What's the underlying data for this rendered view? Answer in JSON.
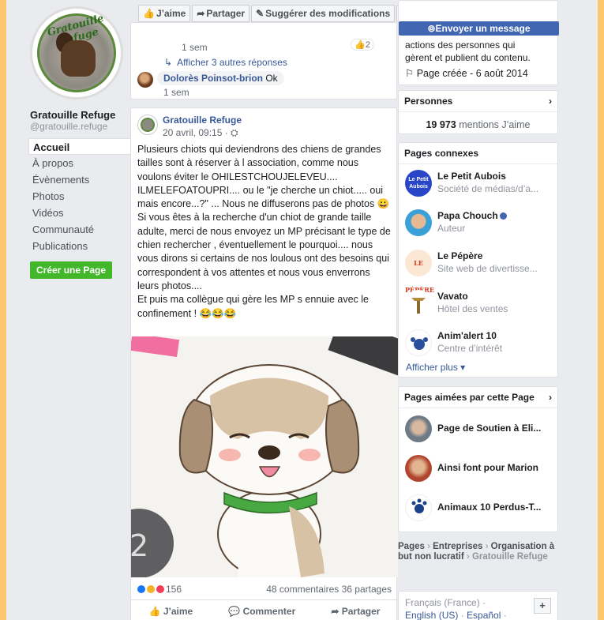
{
  "left": {
    "page_name": "Gratouille Refuge",
    "page_handle": "@gratouille.refuge",
    "nav": [
      "Accueil",
      "À propos",
      "Évènements",
      "Photos",
      "Vidéos",
      "Communauté",
      "Publications"
    ],
    "create_page": "Créer une Page",
    "logo_text": "Gratouille Refuge"
  },
  "actionbar": {
    "like": " J’aime",
    "share": " Partager",
    "suggest": " Suggérer des modifications",
    "more": "···"
  },
  "comments": {
    "time1": "1 sem",
    "badge": "2",
    "more_replies": "Afficher 3 autres réponses",
    "commenter": "Dolorès Poinsot-brion",
    "comment_text": "Ok",
    "time2": "1 sem"
  },
  "post": {
    "author": "Gratouille Refuge",
    "date": "20 avril, 09:15 · ⛭",
    "paragraphs": [
      "Plusieurs chiots qui deviendrons des chiens de grandes tailles sont à réserver à l association, comme nous voulons éviter le OHILESTCHOUJELEVEU.... ILMELEFOATOUPRI.... ou le \"je cherche un chiot..... oui mais encore...?\" ... Nous ne diffuserons pas de photos 😀",
      "Si vous êtes à la recherche d'un chiot de grande taille adulte, merci de nous envoyez un MP précisant le type de chien rechercher , éventuellement le pourquoi.... nous vous dirons si certains de nos loulous ont des besoins qui correspondent à vos attentes et nous vous enverrons leurs photos....",
      "Et puis ma collègue qui gère les MP s ennuie avec le confinement ! 😂😂😂"
    ],
    "image_digit": "2",
    "reactions_count": "156",
    "comments_count": "48 commentaires",
    "shares_count": "36 partages",
    "like": "J’aime",
    "comment": "Commenter",
    "share": "Partager"
  },
  "right": {
    "message_button": "Envoyer un message",
    "about_line1": "actions des personnes qui",
    "about_line2": "gèrent et publient du contenu.",
    "created": "Page créée - 6 août 2014",
    "persons_title": "Personnes",
    "persons_number": "19 973",
    "persons_suffix": " mentions J’aime",
    "related_title": "Pages connexes",
    "related": [
      {
        "name": "Le Petit Aubois",
        "sub": "Société de médias/d’a...",
        "avatar_text": "Le Petit Aubois"
      },
      {
        "name": "Papa Chouch",
        "sub": "Auteur"
      },
      {
        "name": "Le Pépère",
        "sub": "Site web de divertisse...",
        "avatar_text": "LE PÉPÈRE"
      },
      {
        "name": "Vavato",
        "sub": "Hôtel des ventes"
      },
      {
        "name": "Anim'alert 10",
        "sub": "Centre d’intérêt"
      }
    ],
    "show_more": "Afficher plus",
    "liked_title": "Pages aimées par cette Page",
    "liked": [
      "Page de Soutien à Eli...",
      "Ainsi font pour Marion",
      "Animaux 10 Perdus-T..."
    ],
    "crumbs": [
      "Pages",
      "Entreprises",
      "Organisation à but non lucratif",
      "Gratouille Refuge"
    ],
    "lang_current": "Français (France) ·",
    "lang_en": "English (US)",
    "lang_es": "Español"
  }
}
